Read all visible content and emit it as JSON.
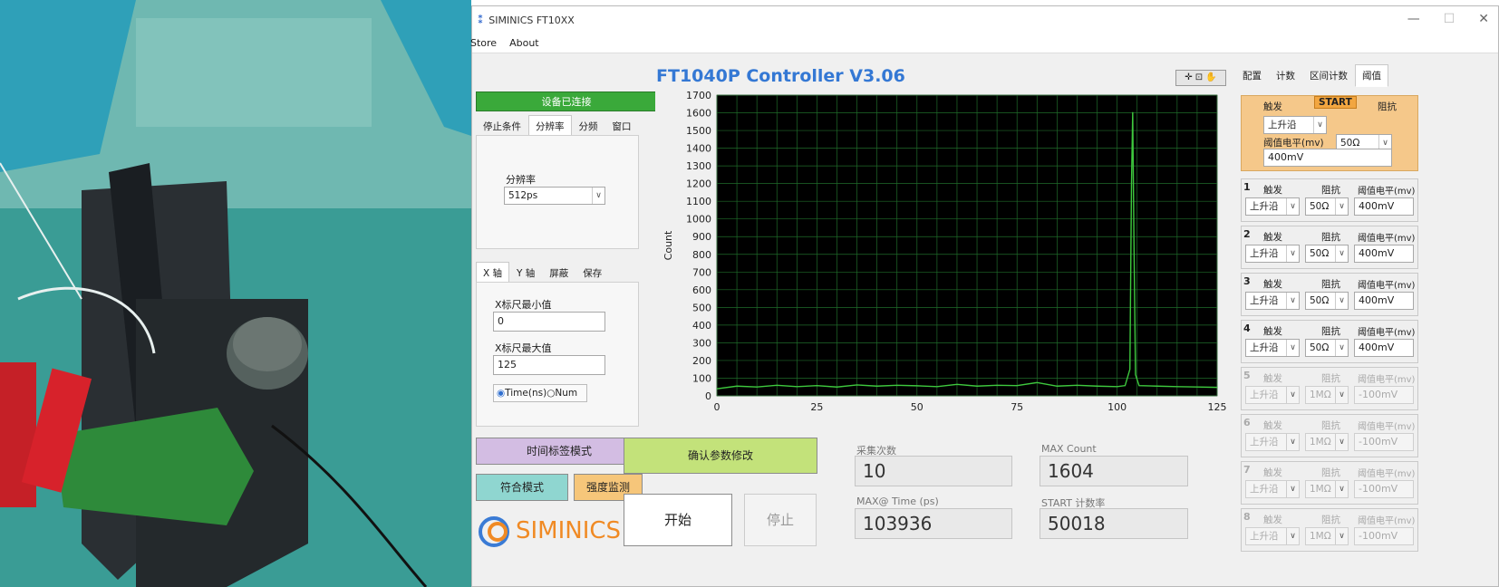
{
  "window": {
    "title": "SIMINICS FT10XX",
    "logo_glyph": "⁑"
  },
  "menu": [
    "Store",
    "About"
  ],
  "status": {
    "connected": "设备已连接"
  },
  "left_tabs": [
    "停止条件",
    "分辨率",
    "分频",
    "窗口"
  ],
  "resolution": {
    "label": "分辨率",
    "value": "512ps"
  },
  "axis_tabs": [
    "X 轴",
    "Y 轴",
    "屏蔽",
    "保存"
  ],
  "x_axis": {
    "min_label": "X标尺最小值",
    "min_value": "0",
    "max_label": "X标尺最大值",
    "max_value": "125",
    "radio_time": "Time(ns)",
    "radio_num": "Num"
  },
  "buttons": {
    "timetag": "时间标签模式",
    "coincidence": "符合模式",
    "intensity": "强度监测",
    "confirm": "确认参数修改",
    "start": "开始",
    "stop": "停止"
  },
  "brand": "SIMINICS",
  "main_title": "FT1040P Controller V3.06",
  "stats": {
    "collect_label": "采集次数",
    "collect_value": "10",
    "maxcount_label": "MAX Count",
    "maxcount_value": "1604",
    "maxtime_label": "MAX@ Time (ps)",
    "maxtime_value": "103936",
    "startrate_label": "START 计数率",
    "startrate_value": "50018"
  },
  "right_tabs": [
    "配置",
    "计数",
    "区间计数",
    "阈值"
  ],
  "start_group": {
    "trigger_label": "触发",
    "start_tag": "START",
    "impedance_label": "阻抗",
    "trigger": "上升沿",
    "impedance": "50Ω",
    "threshold_label": "阈值电平(mv)",
    "threshold": "400mV"
  },
  "channels": [
    {
      "num": "1",
      "trigger_label": "触发",
      "impedance_label": "阻抗",
      "threshold_label": "阈值电平(mv)",
      "trigger": "上升沿",
      "impedance": "50Ω",
      "threshold": "400mV"
    },
    {
      "num": "2",
      "trigger_label": "触发",
      "impedance_label": "阻抗",
      "threshold_label": "阈值电平(mv)",
      "trigger": "上升沿",
      "impedance": "50Ω",
      "threshold": "400mV"
    },
    {
      "num": "3",
      "trigger_label": "触发",
      "impedance_label": "阻抗",
      "threshold_label": "阈值电平(mv)",
      "trigger": "上升沿",
      "impedance": "50Ω",
      "threshold": "400mV"
    },
    {
      "num": "4",
      "trigger_label": "触发",
      "impedance_label": "阻抗",
      "threshold_label": "阈值电平(mv)",
      "trigger": "上升沿",
      "impedance": "50Ω",
      "threshold": "400mV"
    },
    {
      "num": "5",
      "trigger_label": "触发",
      "impedance_label": "阻抗",
      "threshold_label": "阈值电平(mv)",
      "trigger": "上升沿",
      "impedance": "1MΩ",
      "threshold": "-100mV"
    },
    {
      "num": "6",
      "trigger_label": "触发",
      "impedance_label": "阻抗",
      "threshold_label": "阈值电平(mv)",
      "trigger": "上升沿",
      "impedance": "1MΩ",
      "threshold": "-100mV"
    },
    {
      "num": "7",
      "trigger_label": "触发",
      "impedance_label": "阻抗",
      "threshold_label": "阈值电平(mv)",
      "trigger": "上升沿",
      "impedance": "1MΩ",
      "threshold": "-100mV"
    },
    {
      "num": "8",
      "trigger_label": "触发",
      "impedance_label": "阻抗",
      "threshold_label": "阈值电平(mv)",
      "trigger": "上升沿",
      "impedance": "1MΩ",
      "threshold": "-100mV"
    }
  ],
  "chart_data": {
    "type": "line",
    "title": "",
    "xlabel": "",
    "ylabel": "Count",
    "xlim": [
      0,
      125
    ],
    "ylim": [
      0,
      1700
    ],
    "x_ticks": [
      0,
      25,
      50,
      75,
      100,
      125
    ],
    "y_ticks": [
      0,
      100,
      200,
      300,
      400,
      500,
      600,
      700,
      800,
      900,
      1000,
      1100,
      1200,
      1300,
      1400,
      1500,
      1600,
      1700
    ],
    "grid": true,
    "background": "#000000",
    "line_color": "#3ec83e",
    "series": [
      {
        "x": [
          0,
          5,
          10,
          15,
          20,
          25,
          30,
          35,
          40,
          45,
          50,
          55,
          60,
          65,
          70,
          75,
          80,
          85,
          90,
          95,
          100,
          102,
          103.2,
          103.6,
          103.9,
          104.2,
          104.6,
          105.5,
          110,
          115,
          120,
          125
        ],
        "y": [
          40,
          55,
          50,
          60,
          52,
          58,
          50,
          62,
          55,
          60,
          57,
          52,
          65,
          55,
          60,
          58,
          75,
          55,
          60,
          55,
          52,
          58,
          150,
          1200,
          1604,
          900,
          120,
          58,
          55,
          52,
          50,
          48
        ]
      }
    ]
  },
  "colors": {
    "accent_title": "#3478d4",
    "connected_green": "#3aa93a",
    "start_panel": "#f5c88a"
  }
}
